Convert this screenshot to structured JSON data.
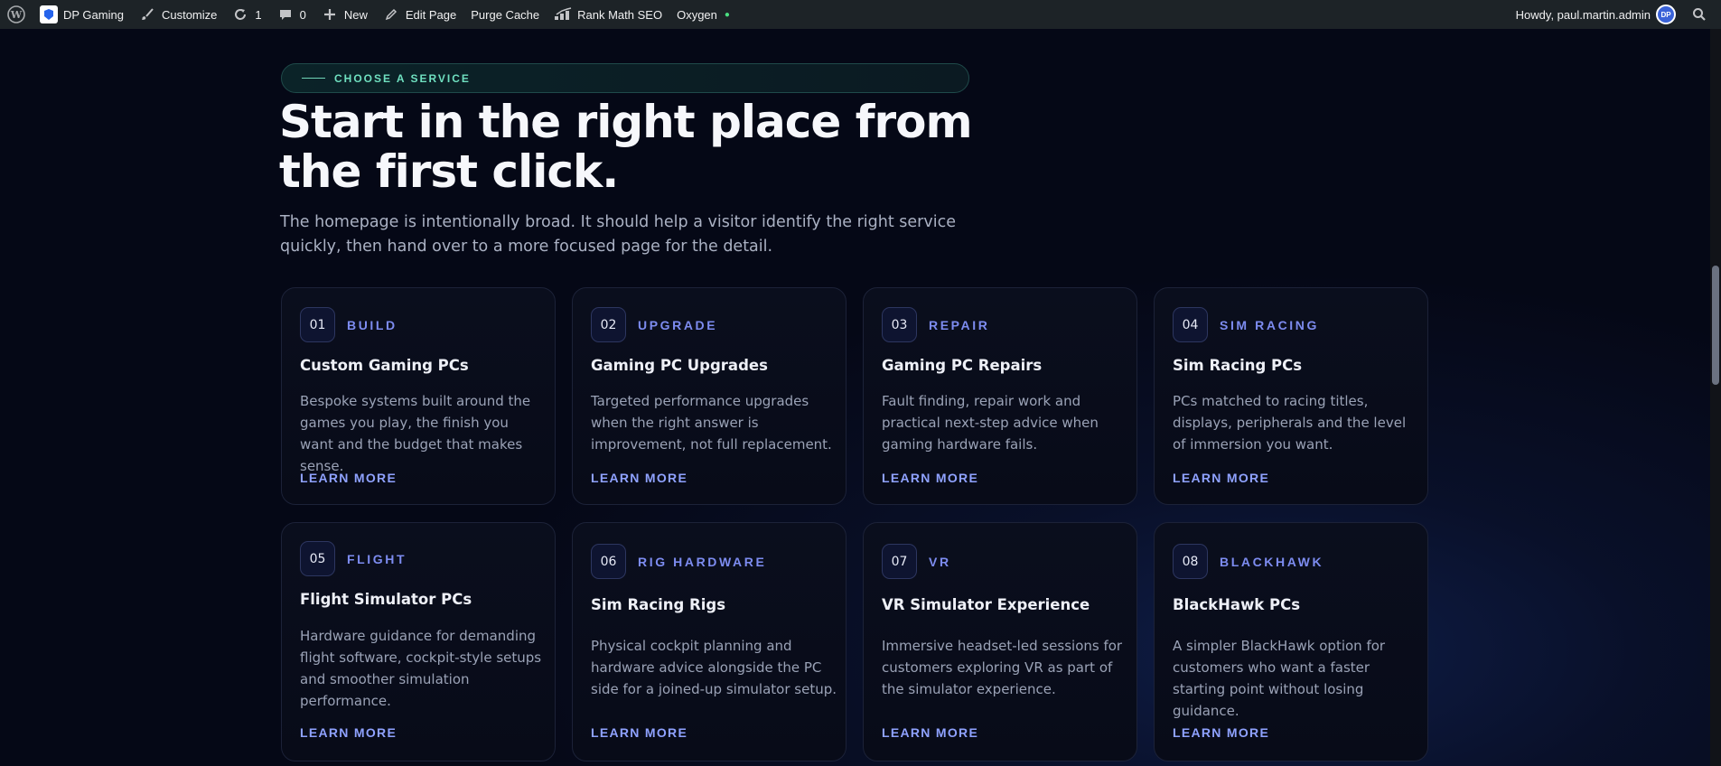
{
  "admin_bar": {
    "site_name": "DP Gaming",
    "customize": "Customize",
    "updates_count": "1",
    "comments_count": "0",
    "new": "New",
    "edit_page": "Edit Page",
    "purge_cache": "Purge Cache",
    "rank_math": "Rank Math SEO",
    "oxygen": "Oxygen",
    "greeting": "Howdy, paul.martin.admin",
    "avatar_initials": "DP",
    "icons": [
      "wordpress-logo-icon",
      "site-logo-icon",
      "brush-icon",
      "updates-icon",
      "comment-icon",
      "plus-icon",
      "pencil-icon",
      "rank-math-icon",
      "search-icon"
    ],
    "oxygen_status_color": "#4ade80"
  },
  "hero": {
    "eyebrow": "CHOOSE A SERVICE",
    "title": "Start in the right place from the first click.",
    "subtitle": "The homepage is intentionally broad. It should help a visitor identify the right service quickly, then hand over to a more focused page for the detail."
  },
  "colors": {
    "background": "#050816",
    "accent": "#7d8cf0",
    "link": "#8fa2ff",
    "eyebrow": "#6fe0c0"
  },
  "services": [
    {
      "num": "01",
      "category": "BUILD",
      "title": "Custom Gaming PCs",
      "description": "Bespoke systems built around the games you play, the finish you want and the budget that makes sense.",
      "link": "LEARN MORE"
    },
    {
      "num": "02",
      "category": "UPGRADE",
      "title": "Gaming PC Upgrades",
      "description": "Targeted performance upgrades when the right answer is improvement, not full replacement.",
      "link": "LEARN MORE"
    },
    {
      "num": "03",
      "category": "REPAIR",
      "title": "Gaming PC Repairs",
      "description": "Fault finding, repair work and practical next-step advice when gaming hardware fails.",
      "link": "LEARN MORE"
    },
    {
      "num": "04",
      "category": "SIM RACING",
      "title": "Sim Racing PCs",
      "description": "PCs matched to racing titles, displays, peripherals and the level of immersion you want.",
      "link": "LEARN MORE"
    },
    {
      "num": "05",
      "category": "FLIGHT",
      "title": "Flight Simulator PCs",
      "description": "Hardware guidance for demanding flight software, cockpit-style setups and smoother simulation performance.",
      "link": "LEARN MORE"
    },
    {
      "num": "06",
      "category": "RIG HARDWARE",
      "title": "Sim Racing Rigs",
      "description": "Physical cockpit planning and hardware advice alongside the PC side for a joined-up simulator setup.",
      "link": "LEARN MORE"
    },
    {
      "num": "07",
      "category": "VR",
      "title": "VR Simulator Experience",
      "description": "Immersive headset-led sessions for customers exploring VR as part of the simulator experience.",
      "link": "LEARN MORE"
    },
    {
      "num": "08",
      "category": "BLACKHAWK",
      "title": "BlackHawk PCs",
      "description": "A simpler BlackHawk option for customers who want a faster starting point without losing guidance.",
      "link": "LEARN MORE"
    }
  ]
}
